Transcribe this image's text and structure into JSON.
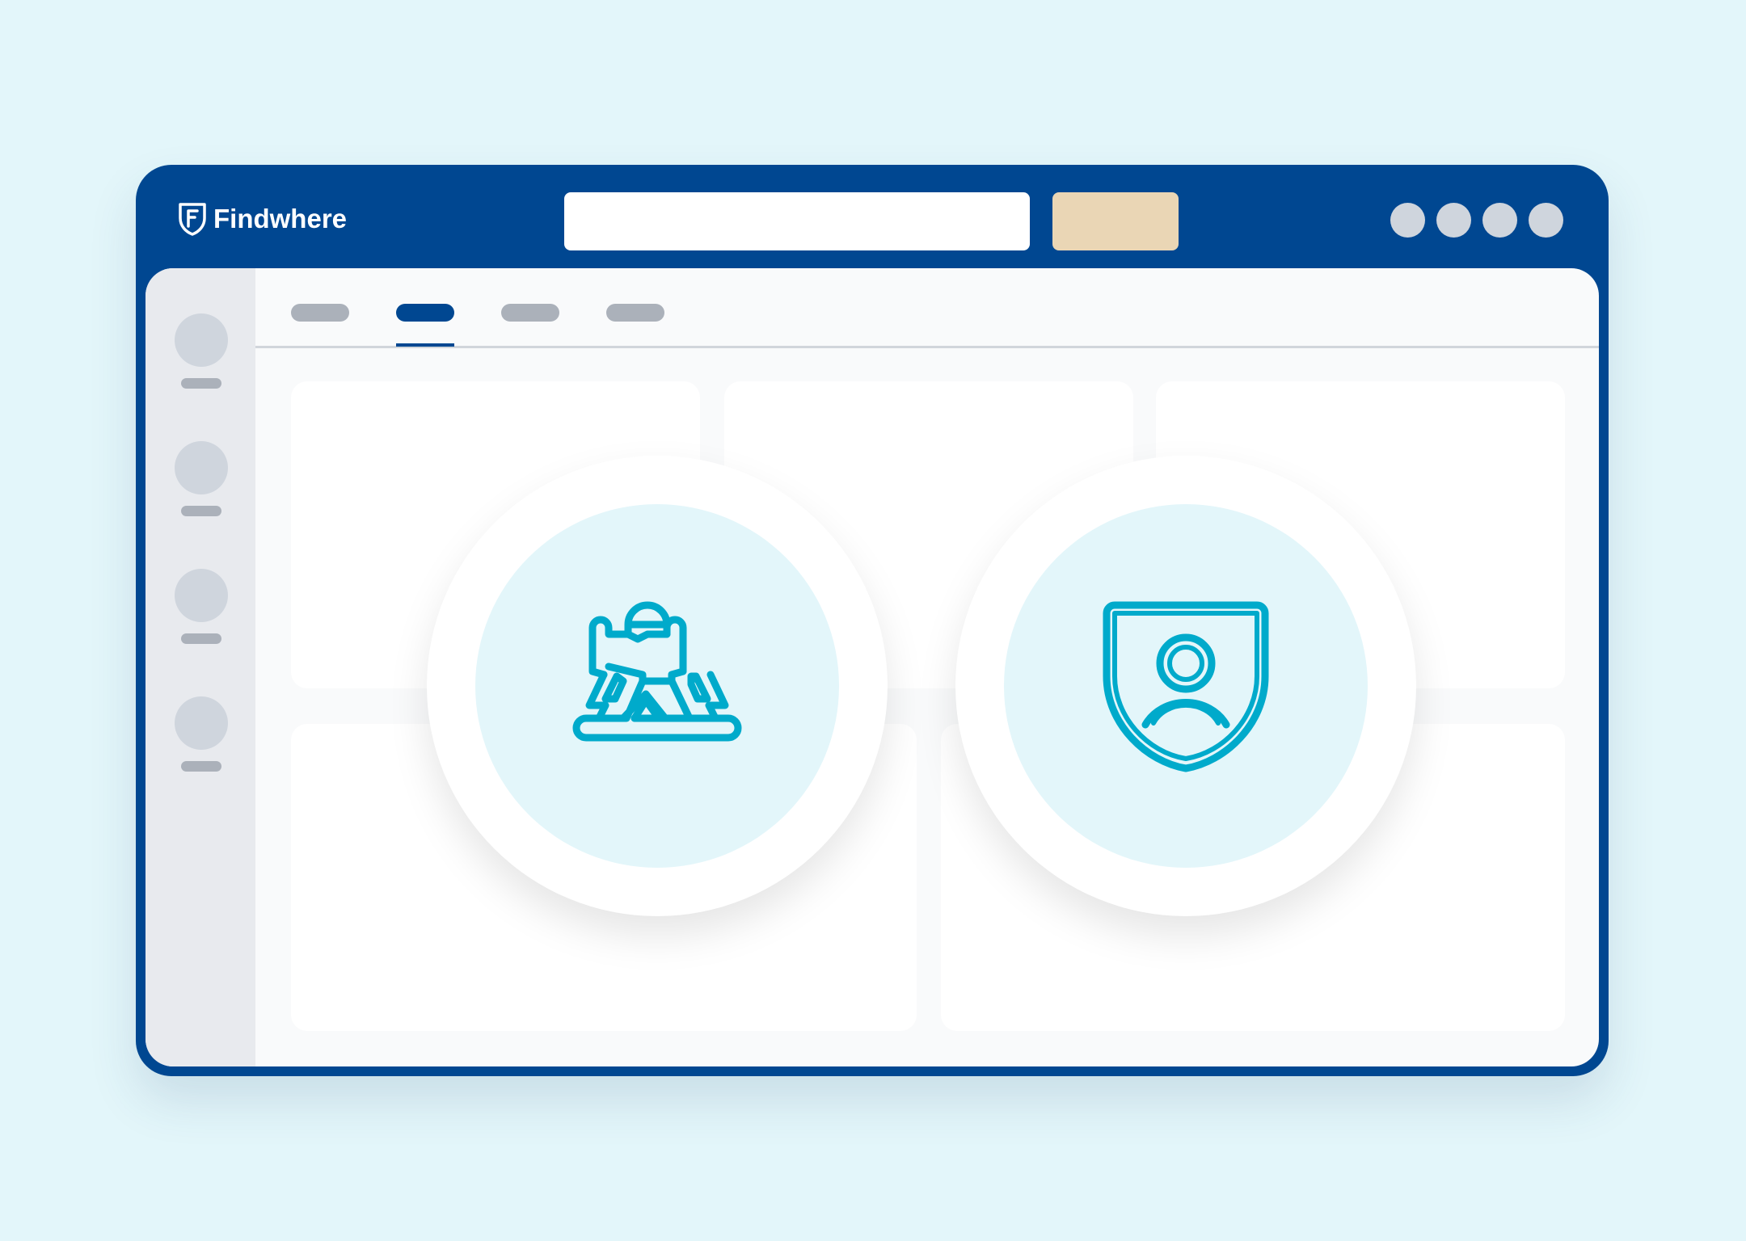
{
  "app": {
    "brand_name": "Findwhere",
    "colors": {
      "background": "#e3f6fa",
      "frame": "#004791",
      "accent_button": "#ead6b5",
      "icon_stroke": "#00aacb",
      "placeholder": "#abb1ba"
    }
  },
  "header": {
    "logo_icon": "shield-f-icon",
    "search": {
      "value": "",
      "placeholder": ""
    },
    "action_button_label": "",
    "toolbar_buttons": [
      "circle-1",
      "circle-2",
      "circle-3",
      "circle-4"
    ]
  },
  "sidebar": {
    "items": [
      {
        "label": ""
      },
      {
        "label": ""
      },
      {
        "label": ""
      },
      {
        "label": ""
      }
    ]
  },
  "tabs": {
    "items": [
      {
        "label": ""
      },
      {
        "label": "",
        "active": true
      },
      {
        "label": ""
      },
      {
        "label": ""
      }
    ]
  },
  "features": [
    {
      "icon": "landmark-statue-icon"
    },
    {
      "icon": "shield-person-icon"
    }
  ]
}
